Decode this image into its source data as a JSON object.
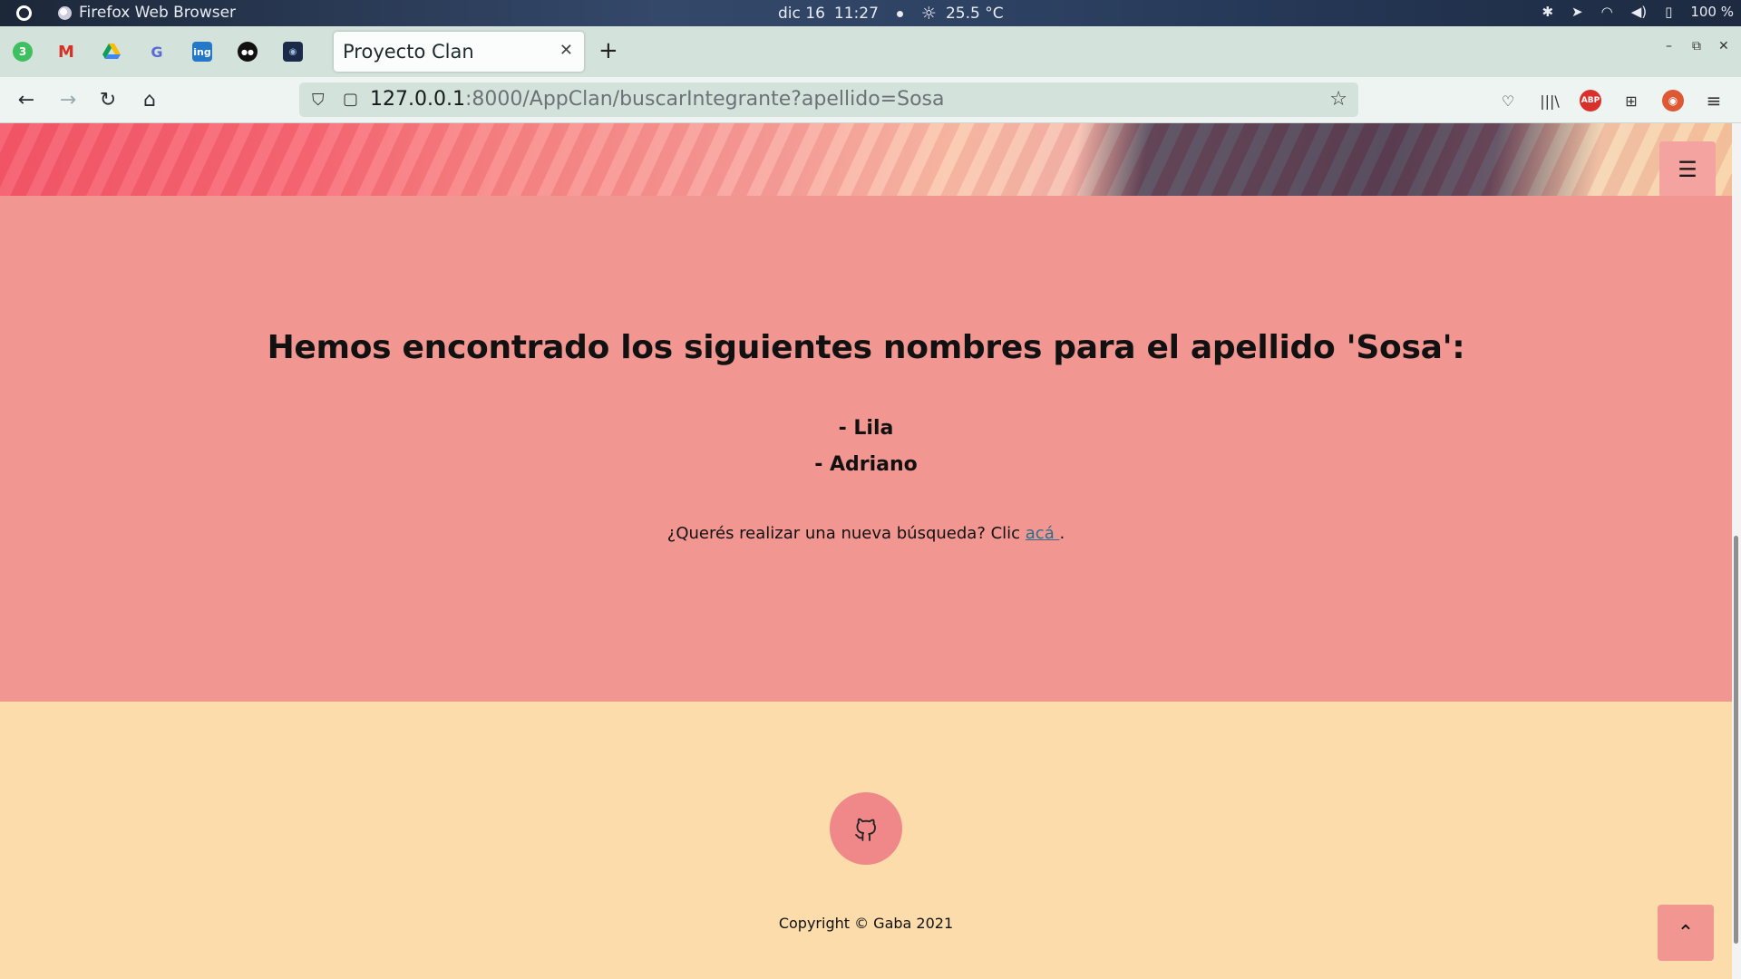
{
  "os": {
    "app_name": "Firefox Web Browser",
    "date": "dic 16",
    "time": "11:27",
    "temperature": "25.5 °C",
    "battery": "100 %"
  },
  "browser": {
    "tab_title": "Proyecto Clan",
    "url_host": "127.0.0.1",
    "url_rest": ":8000/AppClan/buscarIntegrante?apellido=Sosa",
    "pinned_badge": "3",
    "pinned_ing": "ing"
  },
  "page": {
    "heading": "Hemos encontrado los siguientes nombres para el apellido 'Sosa':",
    "names": [
      "- Lila",
      "- Adriano"
    ],
    "again_text": "¿Querés realizar una nueva búsqueda? Clic ",
    "again_link": "acá ",
    "again_end": ".",
    "copyright": "Copyright © Gaba 2021"
  },
  "icons": {
    "menu": "hamburger-icon",
    "github": "github-icon",
    "to_top": "chevron-up-icon"
  },
  "colors": {
    "results_bg": "#f29691",
    "footer_bg": "#fbdcaa",
    "accent": "#f0888a"
  }
}
